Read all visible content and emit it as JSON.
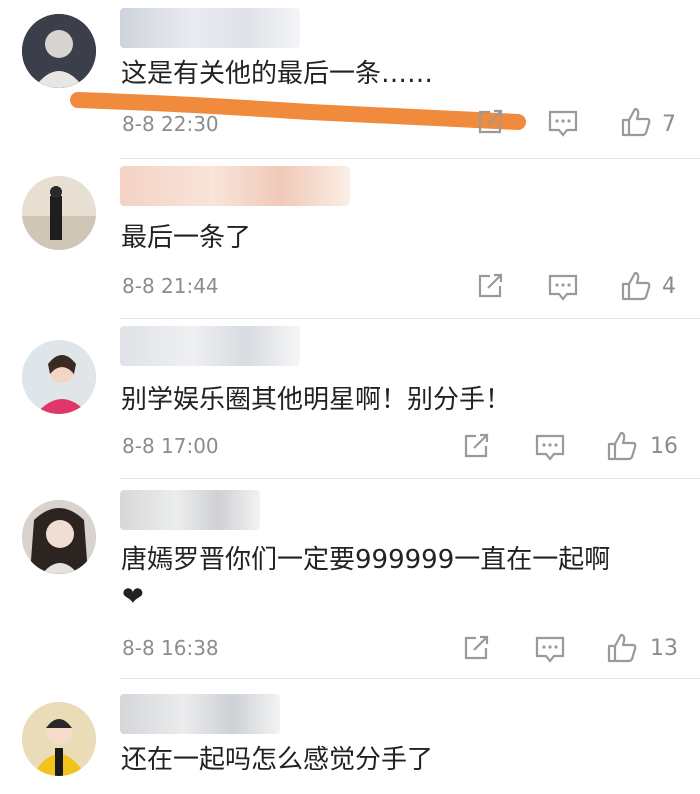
{
  "comments": [
    {
      "username": "",
      "text": "这是有关他的最后一条……",
      "time": "8-8 22:30",
      "likes": "7",
      "avatar_icon": "person-avatar-icon"
    },
    {
      "username": "",
      "text": "最后一条了",
      "time": "8-8 21:44",
      "likes": "4",
      "avatar_icon": "person-avatar-icon"
    },
    {
      "username": "",
      "text": "别学娱乐圈其他明星啊！别分手！",
      "time": "8-8 17:00",
      "likes": "16",
      "avatar_icon": "person-avatar-icon"
    },
    {
      "username": "",
      "text": "唐嫣罗晋你们一定要999999一直在一起啊",
      "emoji": "❤",
      "time": "8-8 16:38",
      "likes": "13",
      "avatar_icon": "person-avatar-icon"
    },
    {
      "username": "",
      "text": "还在一起吗怎么感觉分手了",
      "avatar_icon": "person-avatar-icon"
    }
  ],
  "colors": {
    "annotation_stroke": "#f08a3c",
    "meta_gray": "#8c8c8c"
  }
}
